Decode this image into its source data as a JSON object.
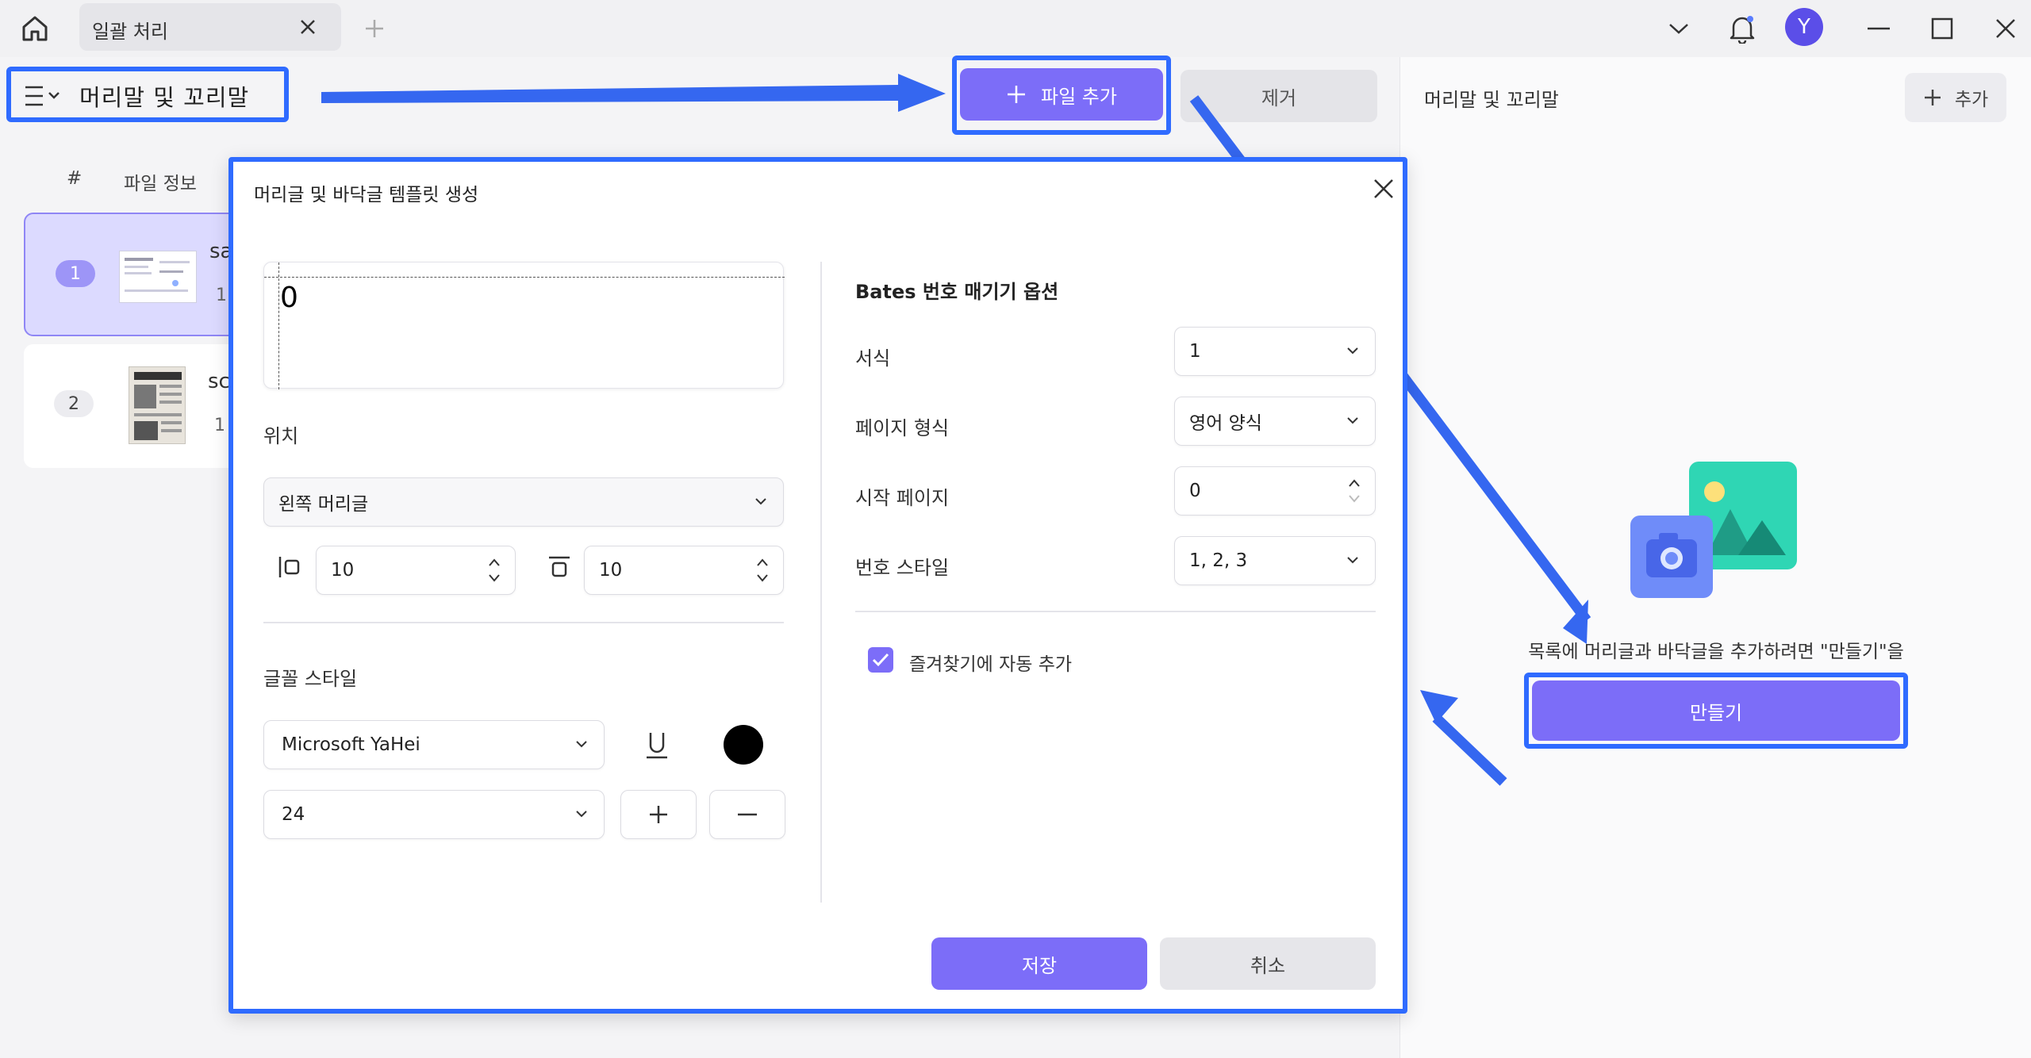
{
  "tab": {
    "title": "일괄 처리"
  },
  "window": {
    "avatar_letter": "Y"
  },
  "toolbar": {
    "tool_name": "머리말 및 꼬리말",
    "add_file_label": "파일 추가",
    "remove_label": "제거"
  },
  "file_list": {
    "col_index": "#",
    "col_info": "파일 정보",
    "items": [
      {
        "index": "1",
        "name_fragment": "sa",
        "meta_fragment": "1"
      },
      {
        "index": "2",
        "name_fragment": "sc",
        "meta_fragment": "1"
      }
    ]
  },
  "right_panel": {
    "title": "머리말 및 꼬리말",
    "add_label": "추가",
    "empty_message": "목록에 머리글과 바닥글을 추가하려면 \"만들기\"을",
    "create_label": "만들기"
  },
  "dialog": {
    "title": "머리글 및 바닥글 템플릿 생성",
    "preview_text": "0",
    "position_label": "위치",
    "position_value": "왼쪽 머리글",
    "margin_h": "10",
    "margin_v": "10",
    "font_style_label": "글꼴 스타일",
    "font_family_value": "Microsoft YaHei",
    "font_size_value": "24",
    "bates_title": "Bates 번호 매기기 옵션",
    "format_label": "서식",
    "format_value": "1",
    "page_format_label": "페이지 형식",
    "page_format_value": "영어 양식",
    "start_page_label": "시작 페이지",
    "start_page_value": "0",
    "number_style_label": "번호 스타일",
    "number_style_value": "1, 2, 3",
    "auto_favorite_label": "즐겨찾기에 자동 추가",
    "save_label": "저장",
    "cancel_label": "취소"
  },
  "colors": {
    "accent": "#7c6df8",
    "highlight": "#2f6bff",
    "font_color": "#000000"
  }
}
